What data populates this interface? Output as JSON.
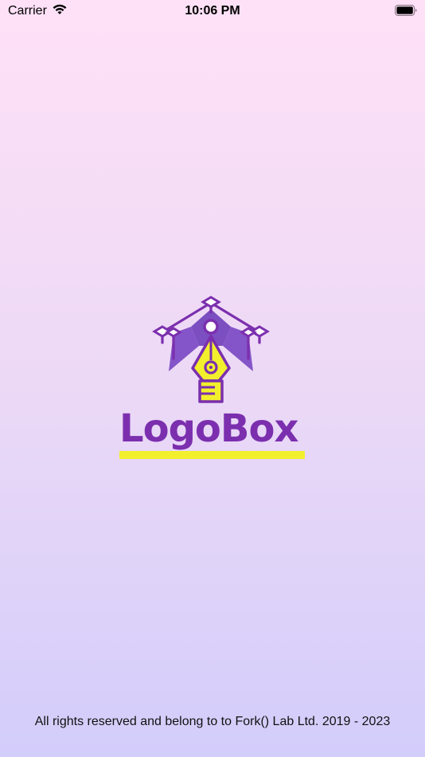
{
  "status_bar": {
    "carrier": "Carrier",
    "time": "10:06 PM",
    "battery_level": 1.0
  },
  "logo": {
    "wordmark": "LogoBox",
    "icon": "pen-nib-icon",
    "colors": {
      "purple": "#7b2fae",
      "yellow": "#f2ef2d"
    }
  },
  "footer": {
    "copyright": "All rights reserved and belong to to Fork() Lab Ltd. 2019 - 2023"
  },
  "colors": {
    "background_top": "#ffe1f7",
    "background_bottom": "#d3cdfb"
  }
}
